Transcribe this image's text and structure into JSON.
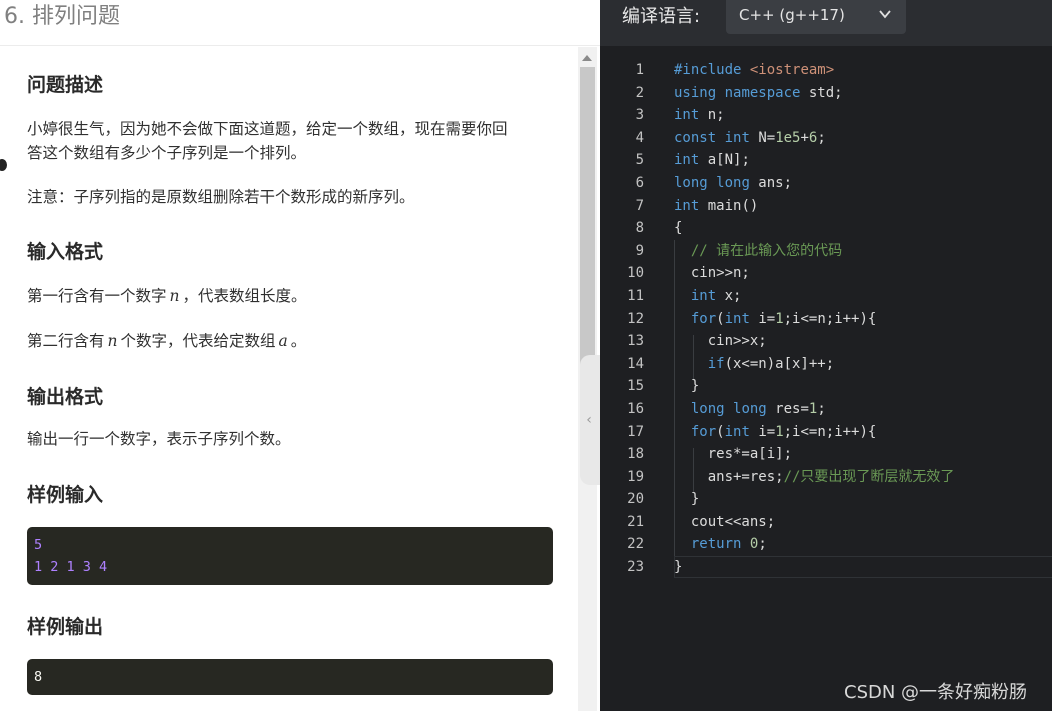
{
  "problem": {
    "title": "6. 排列问题",
    "sections": [
      {
        "heading": "问题描述"
      },
      {
        "heading": "输入格式"
      },
      {
        "heading": "输出格式"
      },
      {
        "heading": "样例输入"
      },
      {
        "heading": "样例输出"
      }
    ],
    "description_line1": "小婷很生气，因为她不会做下面这道题，给定一个数组，现在需要你回",
    "description_line2": "答这个数组有多少个子序列是一个排列。",
    "note": "注意：子序列指的是原数组删除若干个数形成的新序列。",
    "input_line1_pre": "第一行含有一个数字",
    "input_line1_var": "n",
    "input_line1_post": "，代表数组长度。",
    "input_line2_pre": "第二行含有",
    "input_line2_var": "n",
    "input_line2_mid": "个数字，代表给定数组",
    "input_line2_var2": "a",
    "input_line2_post": "。",
    "output_text": "输出一行一个数字，表示子序列个数。",
    "sample_input": [
      "5",
      "1 2 1 3 4"
    ],
    "sample_output": [
      "8"
    ]
  },
  "editor": {
    "lang_label": "编译语言:",
    "lang_value": "C++ (g++17)",
    "line_numbers": [
      "1",
      "2",
      "3",
      "4",
      "5",
      "6",
      "7",
      "8",
      "9",
      "10",
      "11",
      "12",
      "13",
      "14",
      "15",
      "16",
      "17",
      "18",
      "19",
      "20",
      "21",
      "22",
      "23"
    ]
  },
  "watermark": "CSDN @一条好痴粉肠",
  "colors": {
    "editor_bg": "#1e1f22",
    "sample_bg": "#272822",
    "sample_input_text": "#ae81ff",
    "sample_output_text": "#f8f8f2",
    "keyword": "#569cd6",
    "number": "#b5cea8",
    "comment": "#6a9955"
  }
}
